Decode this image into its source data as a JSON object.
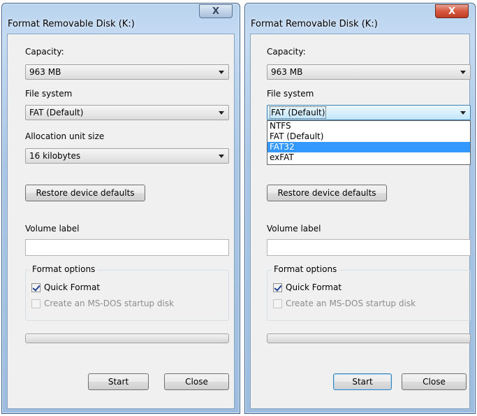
{
  "left_dialog": {
    "title": "Format Removable Disk (K:)",
    "close_glyph": "X",
    "capacity_label": "Capacity:",
    "capacity_value": "963 MB",
    "file_system_label": "File system",
    "file_system_value": "FAT (Default)",
    "allocation_label": "Allocation unit size",
    "allocation_value": "16 kilobytes",
    "restore_button": "Restore device defaults",
    "volume_label": "Volume label",
    "volume_value": "",
    "format_options_label": "Format options",
    "quick_format_label": "Quick Format",
    "quick_format_checked": true,
    "msdos_label": "Create an MS-DOS startup disk",
    "msdos_checked": false,
    "progress": 0,
    "start_button": "Start",
    "close_button": "Close"
  },
  "right_dialog": {
    "title": "Format Removable Disk (K:)",
    "close_glyph": "X",
    "capacity_label": "Capacity:",
    "capacity_value": "963 MB",
    "file_system_label": "File system",
    "file_system_value": "FAT (Default)",
    "file_system_options": [
      "NTFS",
      "FAT (Default)",
      "FAT32",
      "exFAT"
    ],
    "highlighted_option": "FAT32",
    "restore_button": "Restore device defaults",
    "volume_label": "Volume label",
    "volume_value": "",
    "format_options_label": "Format options",
    "quick_format_label": "Quick Format",
    "quick_format_checked": true,
    "msdos_label": "Create an MS-DOS startup disk",
    "msdos_checked": false,
    "progress": 0,
    "start_button": "Start",
    "close_button": "Close"
  },
  "colors": {
    "title_frame": "#a9c6e6",
    "client_bg": "#f0f0f0",
    "highlight": "#3399ff",
    "close_hover": "#d5583f"
  },
  "icons": [
    "close-icon",
    "chevron-down-icon",
    "checkbox-checked-icon"
  ]
}
